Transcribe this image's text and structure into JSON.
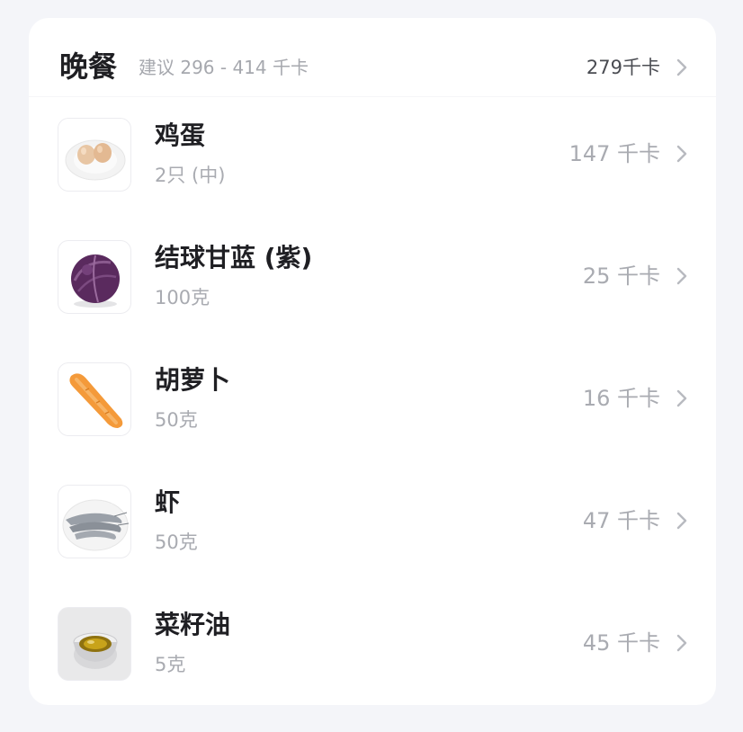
{
  "meal": {
    "title": "晚餐",
    "suggestion": "建议 296 - 414 千卡",
    "total": "279千卡"
  },
  "items": [
    {
      "name": "鸡蛋",
      "quantity": "2只 (中)",
      "kcal": "147 千卡",
      "icon": "eggs-icon"
    },
    {
      "name": "结球甘蓝 (紫)",
      "quantity": "100克",
      "kcal": "25 千卡",
      "icon": "purple-cabbage-icon"
    },
    {
      "name": "胡萝卜",
      "quantity": "50克",
      "kcal": "16 千卡",
      "icon": "carrot-icon"
    },
    {
      "name": "虾",
      "quantity": "50克",
      "kcal": "47 千卡",
      "icon": "shrimp-icon"
    },
    {
      "name": "菜籽油",
      "quantity": "5克",
      "kcal": "45 千卡",
      "icon": "oil-bowl-icon"
    }
  ],
  "colors": {
    "background": "#f4f5f9",
    "card": "#ffffff",
    "title_text": "#1f1f23",
    "muted_text": "#a9abb1"
  }
}
